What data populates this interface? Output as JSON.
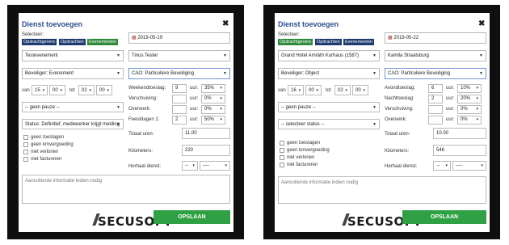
{
  "left": {
    "title": "Dienst toevoegen",
    "selecteer_label": "Selecteer:",
    "tags": [
      {
        "label": "Opdrachtgevers"
      },
      {
        "label": "Opdrachten"
      },
      {
        "label": "Evenementen"
      }
    ],
    "client": "Testevenement",
    "date": "2018-05-19",
    "function": "Beveiliger: Evenement",
    "employee": "Tinus Tester",
    "cao": "CAO: Particuliere Beveiliging",
    "van_label": "van",
    "tot_label": "tot",
    "van_h": "15",
    "van_m": "00",
    "tot_h": "02",
    "tot_m": "00",
    "pause": "-- geen pauze --",
    "status": "Status: Definitief, medewerker krijgt melding",
    "uur_label": "uur:",
    "allowances": [
      {
        "label": "Weekendtoeslag:",
        "value": "9",
        "pct": "35%"
      },
      {
        "label": "Verschuiving:",
        "value": "",
        "pct": "0%"
      },
      {
        "label": "Overwerk:",
        "value": "",
        "pct": "0%"
      },
      {
        "label": "Feestdagen 1:",
        "value": "2",
        "pct": "50%"
      }
    ],
    "total_label": "Totaal uren:",
    "total": "11.00",
    "km_label": "Kilometers:",
    "km": "220",
    "repeat_label": "Herhaal dienst:",
    "repeat_a": "--",
    "repeat_b": "----",
    "checks": [
      "geen toeslagen",
      "geen kmvergoeding",
      "niet verlonen",
      "niet factureren"
    ],
    "notes_placeholder": "Aanvullende informatie indien nodig",
    "save": "OPSLAAN",
    "logo": "SECUSOFT"
  },
  "right": {
    "title": "Dienst toevoegen",
    "selecteer_label": "Selecteer:",
    "tags": [
      {
        "label": "Opdrachtgevers"
      },
      {
        "label": "Opdrachten"
      },
      {
        "label": "Evenementen"
      }
    ],
    "client": "Grand Hotel Amrâth Kurhaus (1587)",
    "date": "2018-05-22",
    "function": "Beveiliger: Object",
    "employee": "Kamila Straatsburg",
    "cao": "CAO: Particuliere Beveiliging",
    "van_label": "van",
    "tot_label": "tot",
    "van_h": "16",
    "van_m": "00",
    "tot_h": "02",
    "tot_m": "00",
    "pause": "-- geen pauze --",
    "status": "-- selecteer status --",
    "uur_label": "uur:",
    "allowances": [
      {
        "label": "Avondtoeslag:",
        "value": "6",
        "pct": "10%"
      },
      {
        "label": "Nachttoeslag:",
        "value": "2",
        "pct": "20%"
      },
      {
        "label": "Verschuiving:",
        "value": "",
        "pct": "0%"
      },
      {
        "label": "Overwerk:",
        "value": "",
        "pct": "0%"
      }
    ],
    "total_label": "Totaal uren:",
    "total": "10.00",
    "km_label": "Kilometers:",
    "km": "546",
    "repeat_label": "Herhaal dienst:",
    "repeat_a": "--",
    "repeat_b": "----",
    "checks": [
      "geen toeslagen",
      "geen kmvergoeding",
      "niet verlonen",
      "niet factureren"
    ],
    "notes_placeholder": "Aanvullende informatie indien nodig",
    "save": "OPSLAAN",
    "logo": "SECUSOFT"
  }
}
